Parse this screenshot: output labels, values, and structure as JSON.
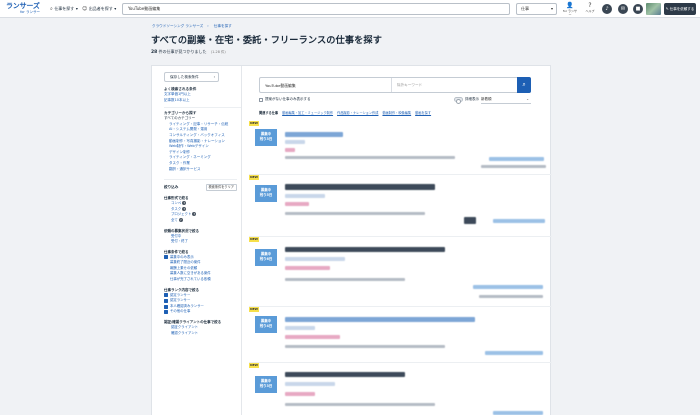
{
  "header": {
    "logo_main": "ランサーズ",
    "logo_sub": "for ランサー",
    "nav": [
      {
        "label": "仕事を探す",
        "icon": "search-icon"
      },
      {
        "label": "出品者を探す",
        "icon": "people-icon"
      }
    ],
    "search_value": "YouTube動画編集",
    "scope_select": "仕事",
    "user_links": [
      {
        "label": "for ランサー",
        "icon": "user-icon"
      },
      {
        "label": "ヘルプ",
        "icon": "help-icon"
      }
    ],
    "post_button": "仕事を依頼する"
  },
  "breadcrumb": [
    "クラウドソーシング ランサーズ",
    "仕事を探す"
  ],
  "page_title": "すべての副業・在宅・委託・フリーランスの仕事を探す",
  "result": {
    "count": "28",
    "suffix": "件の仕事が見つかりました",
    "range": "(1-28 件)"
  },
  "sidebar": {
    "saved_button": "保存した検索条件",
    "often_title": "よく検索される条件",
    "often_links": [
      "文字単価1円以上",
      "記事数10本以上"
    ],
    "category_title": "カテゴリーから探す",
    "all_categories": "すべてのカテゴリー",
    "categories": [
      "ライティング・記事・リサーチ・伝統",
      "AI・システム開発・運用",
      "コンサルティング・バックオフィス",
      "動画制作・写真撮影・ナレーション",
      "Web制作・Webデザイン",
      "デザイン制作",
      "ライティング・ネーミング",
      "タスク・作業",
      "翻訳・通訳サービス"
    ],
    "narrow_title": "絞り込み",
    "clear_button": "検索条件をクリア",
    "style_title": "仕事形式で絞る",
    "styles": [
      "コンペ",
      "タスク",
      "プロジェクト",
      "全て"
    ],
    "period_title": "依頼の募集状況で絞る",
    "periods": [
      "受付中",
      "受付・終了"
    ],
    "status_title": "仕事条件で絞る",
    "status_items": [
      {
        "label": "募集中のみ表示",
        "checked": true
      },
      {
        "label": "募集終了間近の案件",
        "checked": false
      },
      {
        "label": "報酬上乗せの依頼",
        "checked": false
      },
      {
        "label": "募集人数に空きがある案件",
        "checked": false
      },
      {
        "label": "仕事が完了されている依頼",
        "checked": false
      }
    ],
    "rank_title": "仕事ランク内容で絞る",
    "rank_items": [
      {
        "label": "認定ランサー",
        "checked": true
      },
      {
        "label": "認定ランサー",
        "checked": true
      },
      {
        "label": "本人確認済みランサー",
        "checked": true
      },
      {
        "label": "その他の仕事",
        "checked": true
      }
    ],
    "client_title": "認証/確認クライアントの仕事で絞る",
    "client_items": [
      "認証クライアント",
      "確認クライアント"
    ]
  },
  "content": {
    "keyword": "YouTube動画編集",
    "exclude_placeholder": "除外キーワード",
    "option_label": "提案がない仕事のみ表示する",
    "toggle_label": "詳細表示",
    "sort": "新着順",
    "related_label": "関連する仕事",
    "related_links": [
      "動画編集・加工・ミュージック制作",
      "作品撮影・ナレーション作成",
      "動画制作・映像編集",
      "動画を探す"
    ]
  },
  "jobs": [
    {
      "new": "NEW",
      "status": "募集中 残り3日"
    },
    {
      "new": "NEW",
      "status": "募集中 残り5日"
    },
    {
      "new": "NEW",
      "status": "募集中 残り6日"
    },
    {
      "new": "NEW",
      "status": "募集中 残り4日"
    },
    {
      "new": "NEW",
      "status": "募集中 残り3日"
    }
  ]
}
